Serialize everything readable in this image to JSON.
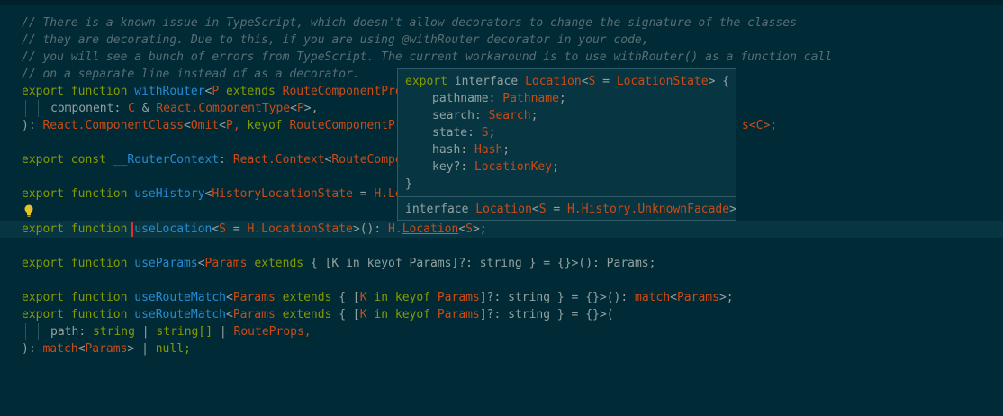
{
  "editor": {
    "lines": [
      {
        "id": "l1",
        "text": "// There is a known issue in TypeScript, which doesn't allow decorators to change the signature of the classes"
      },
      {
        "id": "l2",
        "text": "// they are decorating. Due to this, if you are using @withRouter decorator in your code,"
      },
      {
        "id": "l3",
        "text": "// you will see a bunch of errors from TypeScript. The current workaround is to use withRouter() as a function call"
      },
      {
        "id": "l4",
        "text": "// on a separate line instead of as a decorator."
      }
    ],
    "withRouter": {
      "kw1": "export",
      "kw2": "function",
      "name": "withRouter",
      "lt": "<",
      "P": "P",
      "extends": "extends",
      "rest": "RouteComponentPro"
    },
    "component_line": {
      "name": "component",
      "colon": ":",
      "C": "C",
      "amp": "&",
      "react": "React.",
      "ctype": "ComponentType",
      "lt": "<",
      "P": "P",
      "gt": ">,"
    },
    "return_line": {
      "close": "):",
      "react": "React.",
      "cls": "ComponentClass",
      "lt": "<",
      "omit": "Omit",
      "lt2": "<",
      "P": "P,",
      "keyof": "keyof",
      "rcp": "RouteComponentPr",
      "tail_prefix": "s",
      "tail": "<C>;"
    },
    "router_ctx": {
      "kw1": "export",
      "kw2": "const",
      "name": "__RouterContext",
      "colon": ":",
      "react": "React.",
      "ctx": "Context",
      "lt": "<",
      "route": "RouteCompo"
    },
    "use_history": {
      "kw1": "export",
      "kw2": "function",
      "name": "useHistory",
      "lt": "<",
      "type": "HistoryLocationState",
      "eq": "=",
      "h": "H.Lo"
    },
    "use_location": {
      "kw1": "export",
      "kw2": "function",
      "name": "useLocation",
      "lt": "<",
      "S": "S",
      "eq": "=",
      "h": "H.",
      "ls": "LocationState",
      "close": ">():",
      "h2": "H.",
      "loc": "Location",
      "lt2": "<",
      "S2": "S",
      "end": ">;"
    },
    "use_params": {
      "kw1": "export",
      "kw2": "function",
      "name": "useParams",
      "lt": "<",
      "params": "Params",
      "extends": "extends",
      "body": "{ [K in keyof Params]?: string } = {}>(): Params;"
    },
    "use_route_match1": {
      "kw1": "export",
      "kw2": "function",
      "name": "useRouteMatch",
      "lt": "<",
      "params": "Params",
      "extends": "extends",
      "open": "{ [",
      "K": "K",
      "in": "in",
      "keyof": "keyof",
      "params2": "Params",
      "mid": "]?: string } = {}>():",
      "match": "match",
      "lt2": "<",
      "params3": "Params",
      "end": ">;"
    },
    "use_route_match2": {
      "kw1": "export",
      "kw2": "function",
      "name": "useRouteMatch",
      "lt": "<",
      "params": "Params",
      "extends": "extends",
      "open": "{ [",
      "K": "K",
      "in": "in",
      "keyof": "keyof",
      "params2": "Params",
      "mid": "]?: string } = {}>("
    },
    "path_line": {
      "name": "path",
      "colon": ":",
      "string": "string",
      "bar": "|",
      "string2": "string[]",
      "bar2": "|",
      "rp": "RouteProps,"
    },
    "close_line": {
      "close": "):",
      "match": "match",
      "lt": "<",
      "params": "Params",
      "gt": ">",
      "bar": "|",
      "null": "null;"
    }
  },
  "hover": {
    "decl": {
      "export": "export",
      "interface": "interface",
      "name": "Location",
      "lt": "<",
      "S": "S",
      "eq": "=",
      "ls": "LocationState",
      "end": "> {"
    },
    "fields": [
      {
        "name": "pathname",
        "type": "Pathname"
      },
      {
        "name": "search",
        "type": "Search"
      },
      {
        "name": "state",
        "type": "S"
      },
      {
        "name": "hash",
        "type": "Hash"
      },
      {
        "name": "key?",
        "type": "LocationKey"
      }
    ],
    "close": "}",
    "footer": {
      "interface": "interface",
      "name": "Location",
      "lt": "<",
      "S": "S",
      "eq": "=",
      "ns": "H.History.",
      "uf": "UnknownFacade",
      "gt": ">"
    }
  },
  "colors": {
    "background": "#002b36",
    "keyword": "#859900",
    "function": "#268bd2",
    "type": "#cb4b16",
    "comment": "#586e75",
    "text": "#93a1a1",
    "cursor": "#dc322f"
  },
  "icons": {
    "lightbulb": "lightbulb-icon"
  }
}
